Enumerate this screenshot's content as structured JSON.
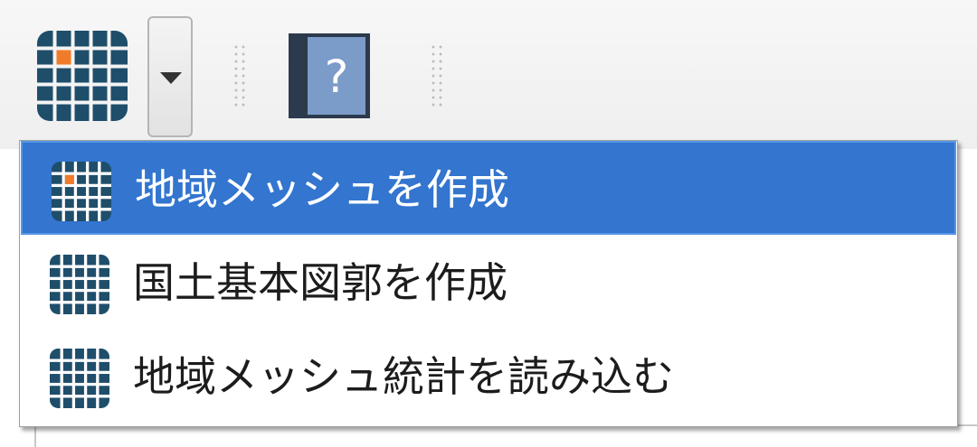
{
  "toolbar": {
    "grid_tool_icon": "grid-mesh-icon",
    "dropdown_icon": "chevron-down-icon",
    "help_icon": "help-book-icon",
    "help_glyph": "?"
  },
  "menu": {
    "items": [
      {
        "label": "地域メッシュを作成",
        "icon": "grid-mesh-icon",
        "selected": true
      },
      {
        "label": "国土基本図郭を作成",
        "icon": "grid-mesh-icon",
        "selected": false
      },
      {
        "label": "地域メッシュ統計を読み込む",
        "icon": "grid-mesh-icon",
        "selected": false
      }
    ]
  },
  "colors": {
    "grid_dark": "#1f4e6b",
    "grid_accent": "#f07c2a",
    "selection": "#3375cf",
    "help_cover": "#2b3a4c",
    "help_page": "#7b9bc9"
  }
}
